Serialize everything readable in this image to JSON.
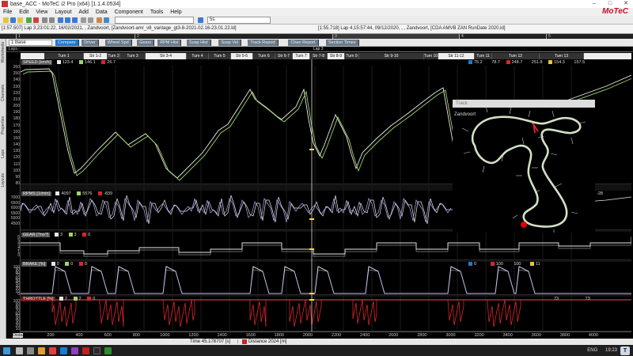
{
  "window": {
    "title": "base_ACC - MoTeC i2 Pro (x64) [1.1.4.0534]",
    "min": "–",
    "max": "□",
    "close": "✕"
  },
  "menu": [
    "File",
    "Edit",
    "View",
    "Layout",
    "Add",
    "Data",
    "Component",
    "Tools",
    "Help"
  ],
  "brand": "MoTeC",
  "toolbar": {
    "zoom_value": "5s"
  },
  "laps": {
    "ref_info": "[1:57.507] Lap 3,23:01:22, 16/02/2021, , Zandvoort, [Zandvoort-amr_v8_vantage_gt3-8-2021.02.16-23.01.22.ld]",
    "cur_info": "[1:55.718] Lap 4,15:57:44, 09/12/2020, , , Zandvoort, [CDA AMVB ZAN RunDate 2020.ld]",
    "markers": [
      "1",
      "2",
      "3",
      "4",
      "5"
    ]
  },
  "left_dock": [
    "Worksheets",
    "Channels",
    "Properties",
    "Laps",
    "Layouts"
  ],
  "workspace": {
    "selector": "1 Base",
    "tabs": [
      "Compare",
      "Driver",
      "Wheel Spd",
      "Gears",
      "RPM Hist",
      "Susp Hist",
      "Susp Vel",
      "Track Report",
      "Chan Report",
      "Section Times"
    ],
    "active_tab": 0,
    "sub_label": "Laps"
  },
  "lap_label": "Lap 3",
  "sectors": [
    "Turn 1",
    "Str 1-2",
    "Turn 2",
    "Turn 3",
    "Str 3-4",
    "Turn 4",
    "Turn 5",
    "Str 5-6",
    "Turn 6",
    "Str 6-7",
    "Turn 7",
    "Str 7-8",
    "Str 8-9",
    "Turn 9",
    "Str 9-10",
    "Turn 10",
    "Str 11-12",
    "Turn 11",
    "Turn 12",
    "Turn 13"
  ],
  "channels": {
    "speed": {
      "name": "SPEED [km/h]",
      "left_vals": [
        "123.4",
        "146.1",
        "26.7"
      ],
      "right_vals": [
        "75.2",
        "78.7",
        "248.7",
        "251.8",
        "154.3",
        "157.5"
      ],
      "yticks": [
        "260",
        "250",
        "240",
        "230",
        "220",
        "210",
        "200",
        "190",
        "180",
        "170",
        "160",
        "150",
        "140",
        "130",
        "120",
        "110",
        "100",
        "90",
        "80"
      ]
    },
    "rpm": {
      "name": "RPMS [1/min]",
      "left_vals": [
        "4097",
        "5576",
        "-839"
      ],
      "right_val": "-28",
      "yticks": [
        "7000",
        "6500",
        "6000",
        "5500",
        "5000",
        "4500"
      ]
    },
    "gear": {
      "name": "GEAR [?no?]",
      "left_vals": [
        "3",
        "3",
        "0"
      ],
      "yticks": [
        "6",
        "5",
        "4",
        "3",
        "2",
        "1",
        "0"
      ]
    },
    "brake": {
      "name": "BRAKE [%]",
      "left_vals": [
        "0",
        "0",
        "0"
      ],
      "right_vals": [
        "0",
        "100",
        "100",
        "11"
      ],
      "yticks": [
        "100",
        "90",
        "80",
        "70",
        "60",
        "50",
        "40",
        "30",
        "20",
        "10",
        "0"
      ]
    },
    "throttle": {
      "name": "THROTTLE [%]",
      "left_vals": [
        "2",
        "2",
        "0"
      ],
      "right_vals": [
        "73",
        "73"
      ],
      "yticks": [
        "100",
        "90",
        "80",
        "70",
        "60",
        "50",
        "40",
        "30",
        "20",
        "10"
      ]
    }
  },
  "colors": {
    "lap_ref": "#e8e8e8",
    "lap_cur": "#9fd56a",
    "rpm_ref": "#b6a6f2",
    "throttle": "#d9252a",
    "cursor": "#f5e12a",
    "section_blue": "#2277cc"
  },
  "track_map": {
    "header": "Track",
    "name": "Zandvoort"
  },
  "x_axis": {
    "label": "Dista",
    "ticks": [
      "200",
      "400",
      "600",
      "800",
      "1000",
      "1200",
      "1400",
      "1600",
      "1800",
      "2000",
      "2200",
      "2400",
      "2600",
      "2800",
      "3000",
      "3200",
      "3400",
      "3600",
      "3800",
      "4000"
    ]
  },
  "status": {
    "time": "Time  45.178707 [s]",
    "distance": "Distance  2024 [m]"
  },
  "taskbar": {
    "lang": "ENG",
    "time": "19:23",
    "pill": "T"
  }
}
